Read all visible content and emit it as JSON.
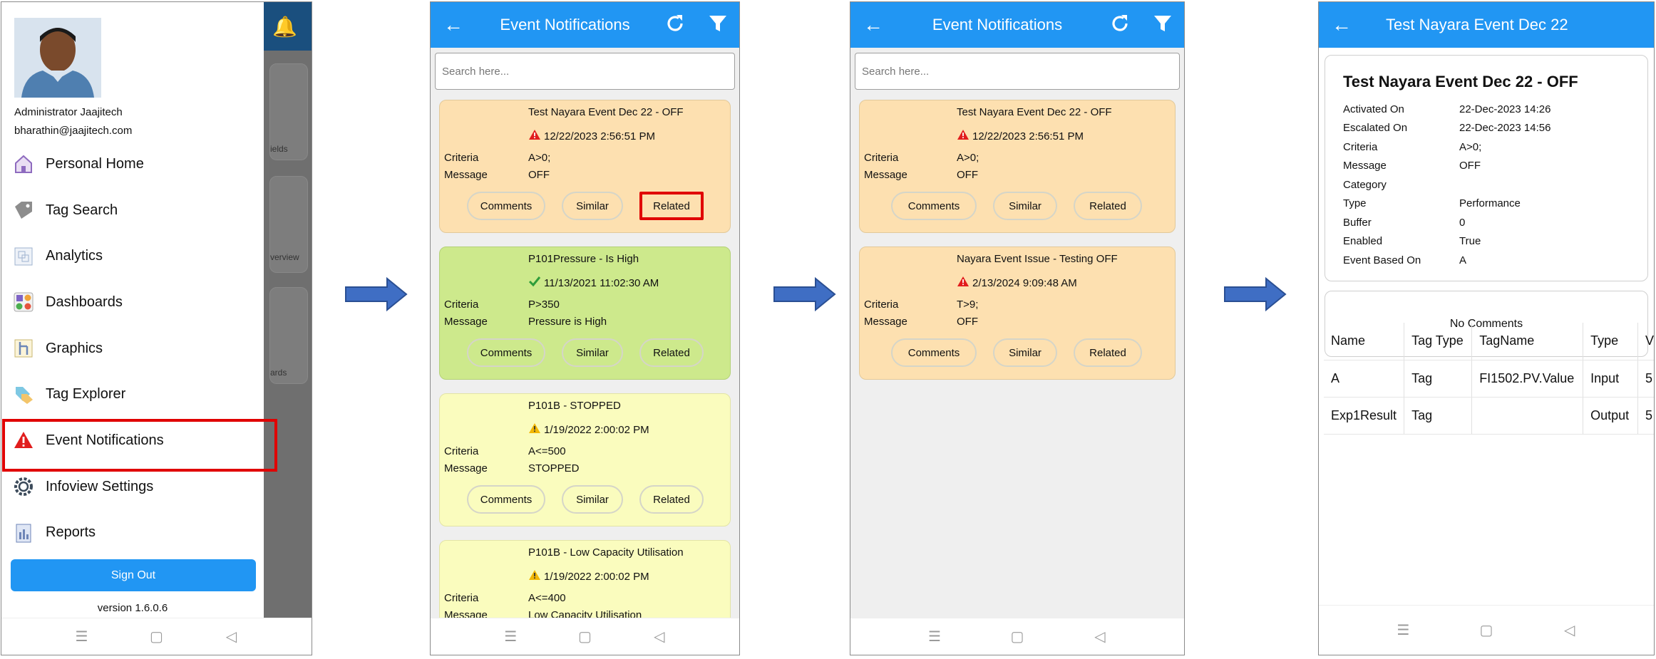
{
  "screen1": {
    "user_name": "Administrator Jaajitech",
    "user_email": "bharathin@jaajitech.com",
    "menu": [
      {
        "label": "Personal Home",
        "icon": "home-icon"
      },
      {
        "label": "Tag Search",
        "icon": "tag-icon"
      },
      {
        "label": "Analytics",
        "icon": "analytics-icon"
      },
      {
        "label": "Dashboards",
        "icon": "dashboard-icon"
      },
      {
        "label": "Graphics",
        "icon": "graphics-icon"
      },
      {
        "label": "Tag Explorer",
        "icon": "tag-explorer-icon"
      },
      {
        "label": "Event Notifications",
        "icon": "warning-icon",
        "active": true
      },
      {
        "label": "Infoview Settings",
        "icon": "settings-icon"
      },
      {
        "label": "Reports",
        "icon": "reports-icon"
      }
    ],
    "sign_out": "Sign Out",
    "version": "version 1.6.0.6",
    "background_fragments": [
      "ields",
      "verview",
      "ards"
    ]
  },
  "list_screen": {
    "title": "Event Notifications",
    "search_placeholder": "Search here..."
  },
  "labels": {
    "criteria": "Criteria",
    "message": "Message",
    "comments": "Comments",
    "similar": "Similar",
    "related": "Related"
  },
  "screen2_cards": [
    {
      "title": "Test Nayara Event Dec 22 - OFF",
      "date": "12/22/2023 2:56:51 PM",
      "criteria": "A>0;",
      "message": "OFF",
      "color": "#fde0b0",
      "status": "alarm"
    },
    {
      "title": "P101Pressure - Is High",
      "date": "11/13/2021 11:02:30 AM",
      "criteria": "P>350",
      "message": "Pressure is High",
      "color": "#cde98c",
      "status": "ok"
    },
    {
      "title": "P101B - STOPPED",
      "date": "1/19/2022 2:00:02 PM",
      "criteria": "A<=500",
      "message": "STOPPED",
      "color": "#fafcbe",
      "status": "warning"
    },
    {
      "title": "P101B - Low Capacity Utilisation",
      "date": "1/19/2022 2:00:02 PM",
      "criteria": "A<=400",
      "message": "Low Capacity Utilisation",
      "color": "#fafcbe",
      "status": "warning"
    }
  ],
  "screen3_cards": [
    {
      "title": "Test Nayara Event Dec 22 - OFF",
      "date": "12/22/2023 2:56:51 PM",
      "criteria": "A>0;",
      "message": "OFF",
      "color": "#fde0b0",
      "status": "alarm"
    },
    {
      "title": "Nayara Event Issue - Testing OFF",
      "date": "2/13/2024 9:09:48 AM",
      "criteria": "T>9;",
      "message": "OFF",
      "color": "#fde0b0",
      "status": "alarm"
    }
  ],
  "screen4": {
    "title": "Test Nayara Event Dec 22",
    "heading": "Test Nayara Event Dec 22 - OFF",
    "details": [
      {
        "key": "Activated On",
        "value": "22-Dec-2023 14:26"
      },
      {
        "key": "Escalated On",
        "value": "22-Dec-2023 14:56"
      },
      {
        "key": "Criteria",
        "value": "A>0;"
      },
      {
        "key": "Message",
        "value": "OFF"
      },
      {
        "key": "Category",
        "value": ""
      },
      {
        "key": "Type",
        "value": "Performance"
      },
      {
        "key": "Buffer",
        "value": "0"
      },
      {
        "key": "Enabled",
        "value": "True"
      },
      {
        "key": "Event Based On",
        "value": "A"
      }
    ],
    "no_comments": "No Comments",
    "table_headers": [
      "Name",
      "Tag Type",
      "TagName",
      "Type",
      "V"
    ],
    "table_rows": [
      [
        "A",
        "Tag",
        "FI1502.PV.Value",
        "Input",
        "5"
      ],
      [
        "Exp1Result",
        "Tag",
        "",
        "Output",
        "5"
      ]
    ]
  },
  "colors": {
    "accent": "#2196f3",
    "highlight": "#e00000",
    "arrow": "#3f6ec4"
  }
}
